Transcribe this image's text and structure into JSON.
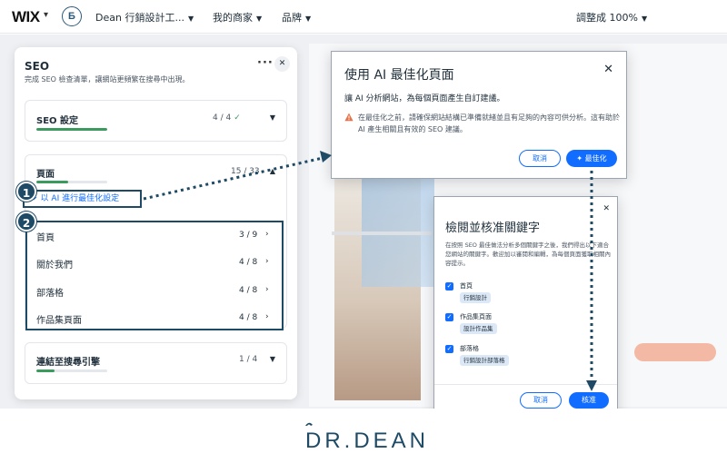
{
  "topbar": {
    "logo": "WIX",
    "site_logo_letter": "Б",
    "site_name": "Dean 行銷設計工...",
    "my_business": "我的商家",
    "brand": "品牌",
    "zoom": "調整成 100%"
  },
  "seo_panel": {
    "title": "SEO",
    "subtitle": "完成 SEO 檢查清單，讓網站更頻繁在搜尋中出現。",
    "more_icon": "more-icon",
    "sections": {
      "settings": {
        "title": "SEO 設定",
        "count": "4 / 4",
        "progress": 1.0
      },
      "pages": {
        "title": "頁面",
        "count": "15 / 33",
        "progress": 0.45
      },
      "connect": {
        "title": "連結至搜尋引擎",
        "count": "1 / 4",
        "progress": 0.25
      }
    },
    "ai_button": "以 AI 進行最佳化設定",
    "page_items": [
      {
        "label": "首頁",
        "count": "3 / 9"
      },
      {
        "label": "關於我們",
        "count": "4 / 8"
      },
      {
        "label": "部落格",
        "count": "4 / 8"
      },
      {
        "label": "作品集頁面",
        "count": "4 / 8"
      }
    ]
  },
  "badges": {
    "one": "1",
    "two": "2"
  },
  "ai_dialog": {
    "title": "使用 AI 最佳化頁面",
    "description": "讓 AI 分析網站，為每個頁面產生自訂建議。",
    "warning": "在最佳化之前，請確保網站結構已準備就緒並且有足夠的內容可供分析。這有助於 AI 產生相關且有效的 SEO 建議。",
    "cancel": "取消",
    "optimize": "最佳化"
  },
  "keyword_dialog": {
    "title": "檢閱並核准關鍵字",
    "description": "在按照 SEO 最佳做法分析多個關鍵字之後，我們得出以下適合您網站的關鍵字。歡迎加以審閱和編輯，為每個頁面獲取相關內容提示。",
    "items": [
      {
        "page": "首頁",
        "keyword": "行銷設計"
      },
      {
        "page": "作品集頁面",
        "keyword": "設計作品集"
      },
      {
        "page": "部落格",
        "keyword": "行銷設計部落格"
      }
    ],
    "cancel": "取消",
    "approve": "核准"
  },
  "footer": {
    "brand": "DR.DEAN"
  },
  "colors": {
    "accent": "#116dff",
    "brand_navy": "#1e4a66",
    "progress_green": "#3b9b5e"
  }
}
